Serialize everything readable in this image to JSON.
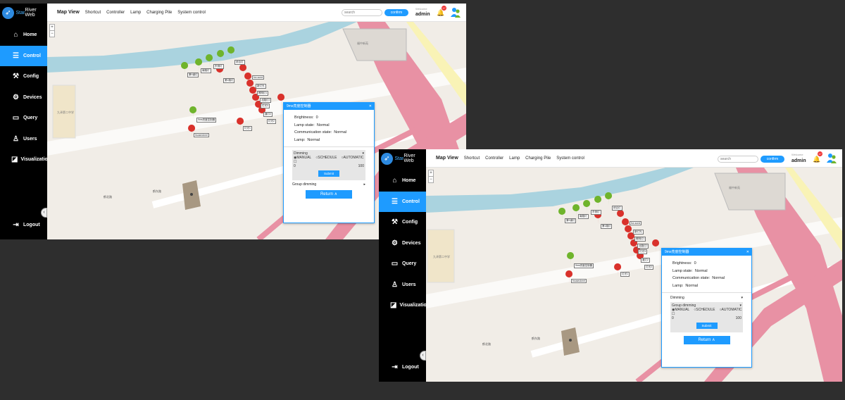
{
  "app": {
    "brand_star": "Star",
    "brand_rest": "River Web"
  },
  "sidebar": {
    "items": [
      {
        "label": "Home",
        "icon": "home-icon"
      },
      {
        "label": "Control",
        "icon": "sliders-icon",
        "active": true
      },
      {
        "label": "Config",
        "icon": "config-icon"
      },
      {
        "label": "Devices",
        "icon": "gear-icon"
      },
      {
        "label": "Query",
        "icon": "query-icon"
      },
      {
        "label": "Users",
        "icon": "user-icon"
      },
      {
        "label": "Visualization",
        "icon": "chart-icon"
      }
    ],
    "logout": "Logout"
  },
  "topbar": {
    "menu": [
      "Map View",
      "Shortcut",
      "Controller",
      "Lamp",
      "Charging Pile",
      "System control"
    ],
    "search_placeholder": "search",
    "confirm": "confirm",
    "welcome": "Welcome",
    "user": "admin",
    "notifications": "17"
  },
  "map": {
    "labels": {
      "school": "九泽第二中学",
      "district": "福中新苑",
      "road": "鹤东路",
      "road2": "鹤北路"
    },
    "lamps": [
      "第9道灯",
      "南路灯",
      "东侧灯",
      "综合灯",
      "第1路灯",
      "fox.sond",
      "照明灯1",
      "北路灯2",
      "道灯2",
      "hsoseokmrl",
      "9ms亮度控制器",
      "灯光1",
      "灯光2",
      "灯光3",
      "新灯光"
    ]
  },
  "popup": {
    "title": "9ms亮度控制器",
    "brightness_label": "Brightness:",
    "brightness": "0",
    "lamp_state_label": "Lamp state:",
    "lamp_state": "Normal",
    "comm_label": "Communication state:",
    "comm_state": "Normal",
    "lamp_label": "Lamp:",
    "lamp": "Normal",
    "dimming": "Dimming",
    "group_dimming": "Group dimming",
    "modes": [
      "MANUAL",
      "SCHEDULE",
      "AUTOMATIC"
    ],
    "min": "0",
    "max": "100",
    "submit": "Submit",
    "return": "Return"
  },
  "colors": {
    "accent": "#1e9bff",
    "marker_red": "#d9312b",
    "marker_green": "#6fb42c",
    "sidebar": "#000000"
  }
}
